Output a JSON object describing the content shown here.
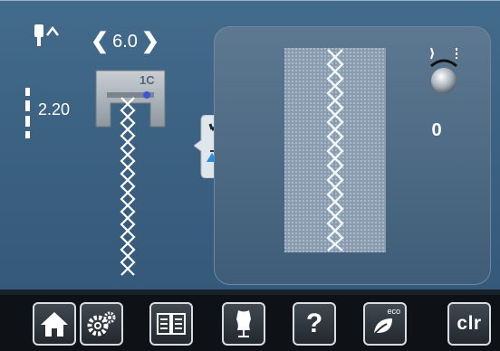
{
  "needle_position": {
    "value": "6.0",
    "icon": "needle-up-icon"
  },
  "stitch_length": {
    "value": "2.20"
  },
  "presser_foot": {
    "label": "1C"
  },
  "thread_tension": {
    "value": "0",
    "icon": "tension-dial-icon"
  },
  "toolbar": {
    "items": [
      {
        "icon": "home-icon"
      },
      {
        "icon": "settings-icon"
      },
      {
        "icon": "manual-book-icon"
      },
      {
        "icon": "dressmaker-dummy-icon"
      },
      {
        "icon": "help-icon",
        "label": "?"
      },
      {
        "icon": "eco-icon",
        "label": "eco"
      },
      {
        "icon": "clear-icon",
        "label": "clr"
      }
    ]
  },
  "colors": {
    "screen_bg": "#3b6080",
    "panel_bg": "#4b6882",
    "toolbar_bg": "#0e1217",
    "accent_blue": "#2a8be0"
  }
}
